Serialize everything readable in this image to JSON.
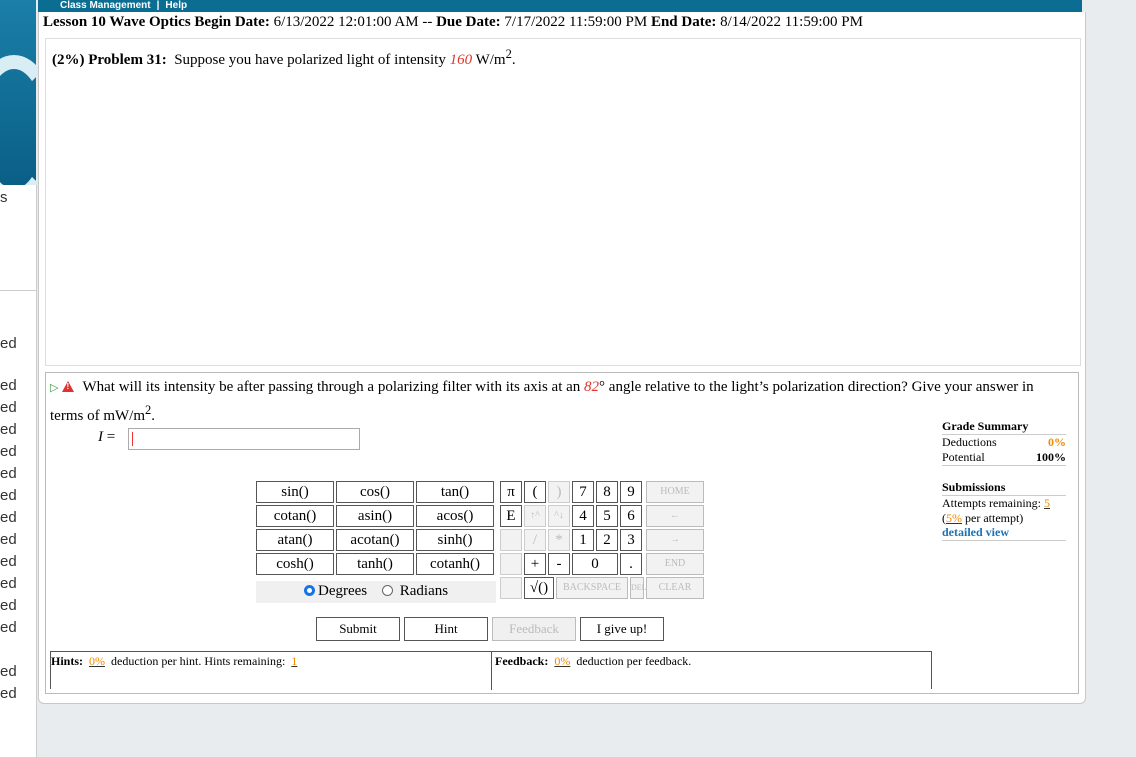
{
  "nav": {
    "class_management": "Class Management",
    "help": "Help"
  },
  "side_fragments": [
    "s",
    "ed",
    "ed",
    "ed",
    "ed",
    "ed",
    "ed",
    "ed",
    "ed",
    "ed",
    "ed",
    "ed",
    "ed",
    "ed",
    "ed",
    "ed"
  ],
  "lesson": {
    "title": "Lesson 10 Wave Optics",
    "begin_label": "Begin Date:",
    "begin_value": "6/13/2022 12:01:00 AM",
    "dash": "--",
    "due_label": "Due Date:",
    "due_value": "7/17/2022 11:59:00 PM",
    "end_label": "End Date:",
    "end_value": "8/14/2022 11:59:00 PM"
  },
  "problem": {
    "weight": "(2%)",
    "number": "Problem 31:",
    "text_before": "Suppose you have polarized light of intensity",
    "intensity": "160",
    "unit": "W/m",
    "unit_sup": "2",
    "period": "."
  },
  "question": {
    "text_a": "What will its intensity be after passing through a polarizing filter with its axis at an",
    "angle": "82",
    "text_b": "° angle relative to the light’s polarization direction? Give your answer in terms of mW/m",
    "sup": "2",
    "end": "."
  },
  "answer": {
    "var": "I",
    "eq": " = ",
    "value": ""
  },
  "calculator": {
    "functions": [
      [
        "sin()",
        "cos()",
        "tan()"
      ],
      [
        "cotan()",
        "asin()",
        "acos()"
      ],
      [
        "atan()",
        "acotan()",
        "sinh()"
      ],
      [
        "cosh()",
        "tanh()",
        "cotanh()"
      ]
    ],
    "symbols": [
      "π",
      "E"
    ],
    "paren_open": "(",
    "paren_close": ")",
    "arrow_up": "↑^",
    "arrow_down": "^↓",
    "divide": "/",
    "multiply": "*",
    "plus": "+",
    "minus": "-",
    "sqrt": "√()",
    "digits": [
      [
        "7",
        "8",
        "9"
      ],
      [
        "4",
        "5",
        "6"
      ],
      [
        "1",
        "2",
        "3"
      ]
    ],
    "zero": "0",
    "dot": ".",
    "home": "HOME",
    "left": "←",
    "right": "→",
    "end": "END",
    "backspace": "BACKSPACE",
    "del": "DEL",
    "clear": "CLEAR",
    "degrees": "Degrees",
    "radians": "Radians",
    "mode": "Degrees"
  },
  "buttons": {
    "submit": "Submit",
    "hint": "Hint",
    "feedback": "Feedback",
    "give_up": "I give up!"
  },
  "hints": {
    "label": "Hints:",
    "pct": "0%",
    "text": "deduction per hint. Hints remaining:",
    "remaining": "1"
  },
  "feedback": {
    "label": "Feedback:",
    "pct": "0%",
    "text": "deduction per feedback."
  },
  "grade_summary": {
    "title": "Grade Summary",
    "deductions_label": "Deductions",
    "deductions_value": "0%",
    "potential_label": "Potential",
    "potential_value": "100%",
    "submissions_title": "Submissions",
    "attempts_label": "Attempts remaining:",
    "attempts_value": "5",
    "per_attempt_pct": "5%",
    "per_attempt_text": "per attempt)",
    "open_paren": "(",
    "detailed_view": "detailed view"
  },
  "colors": {
    "accent_red": "#e0362c",
    "orange": "#ef8a00",
    "link_blue": "#1a73b8",
    "nav_blue": "#0b6d91"
  }
}
